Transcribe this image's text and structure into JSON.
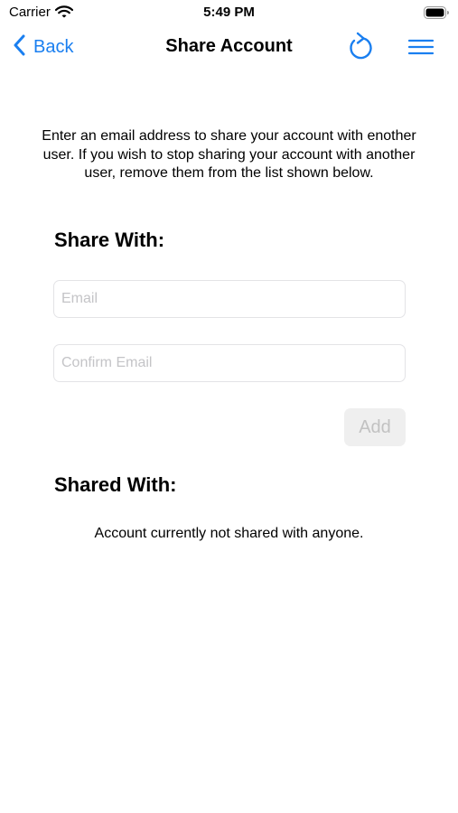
{
  "status_bar": {
    "carrier": "Carrier",
    "time": "5:49 PM"
  },
  "nav": {
    "back_label": "Back",
    "title": "Share Account",
    "accent_color": "#1a7ff0",
    "icons": [
      "chevron-left-icon",
      "refresh-icon",
      "hamburger-menu-icon"
    ]
  },
  "intro_text": "Enter an email address to share your account with enother user. If you wish to stop sharing your account with another user, remove them from the list shown below.",
  "share_with": {
    "heading": "Share With:",
    "email_placeholder": "Email",
    "confirm_email_placeholder": "Confirm Email",
    "email_value": "",
    "confirm_email_value": "",
    "add_button_label": "Add",
    "add_button_disabled": true
  },
  "shared_with": {
    "heading": "Shared With:",
    "empty_message": "Account currently not shared with anyone.",
    "users": []
  }
}
